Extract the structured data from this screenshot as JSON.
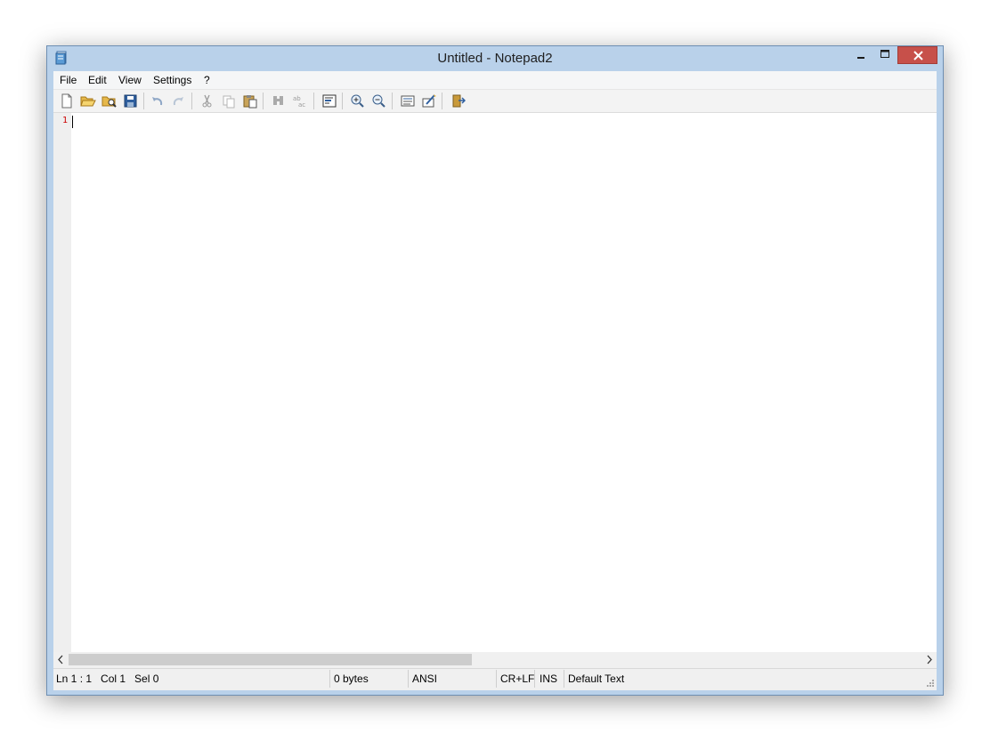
{
  "window": {
    "title": "Untitled - Notepad2",
    "controls": [
      "minimize-icon",
      "maximize-icon",
      "close-icon"
    ],
    "close_color": "#c7504a"
  },
  "menu": {
    "items": [
      "File",
      "Edit",
      "View",
      "Settings",
      "?"
    ]
  },
  "toolbar": {
    "icons": [
      "new-file-icon",
      "open-folder-icon",
      "browse-icon",
      "save-icon",
      "undo-icon",
      "redo-icon",
      "cut-icon",
      "copy-icon",
      "paste-icon",
      "find-icon",
      "replace-icon",
      "word-wrap-icon",
      "zoom-in-icon",
      "zoom-out-icon",
      "scheme-icon",
      "customize-scheme-icon",
      "exit-icon"
    ]
  },
  "editor": {
    "line_numbers": [
      "1"
    ],
    "line_number_color": "#cc0000"
  },
  "statusbar": {
    "position": "Ln 1 : 1   Col 1   Sel 0",
    "size": "0 bytes",
    "encoding": "ANSI",
    "line_endings": "CR+LF",
    "insert_mode": "INS",
    "scheme": "Default Text"
  }
}
